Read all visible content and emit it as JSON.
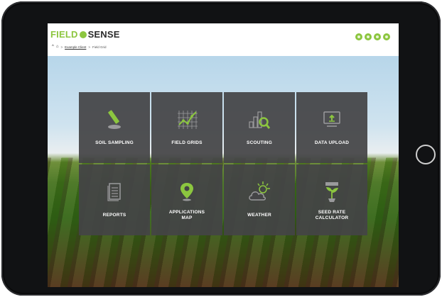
{
  "app": {
    "logo_part1": "FIELD",
    "logo_part2": "SENSE",
    "brand_color": "#8cc63f"
  },
  "breadcrumb": {
    "home_icon": "home-icon",
    "link": "Example Client",
    "current": "Field Grid"
  },
  "header_icons": [
    "user-icon",
    "map-icon",
    "info-icon",
    "grid-icon"
  ],
  "tiles": [
    {
      "label": "SOIL SAMPLING",
      "icon": "soil-probe-icon"
    },
    {
      "label": "FIELD GRIDS",
      "icon": "field-grid-icon"
    },
    {
      "label": "SCOUTING",
      "icon": "scouting-magnifier-icon"
    },
    {
      "label": "DATA UPLOAD",
      "icon": "upload-icon"
    },
    {
      "label": "REPORTS",
      "icon": "report-document-icon"
    },
    {
      "label": "APPLICATIONS\nMAP",
      "icon": "map-pin-icon"
    },
    {
      "label": "WEATHER",
      "icon": "weather-icon"
    },
    {
      "label": "SEED RATE\nCALCULATOR",
      "icon": "seed-plant-icon"
    }
  ]
}
